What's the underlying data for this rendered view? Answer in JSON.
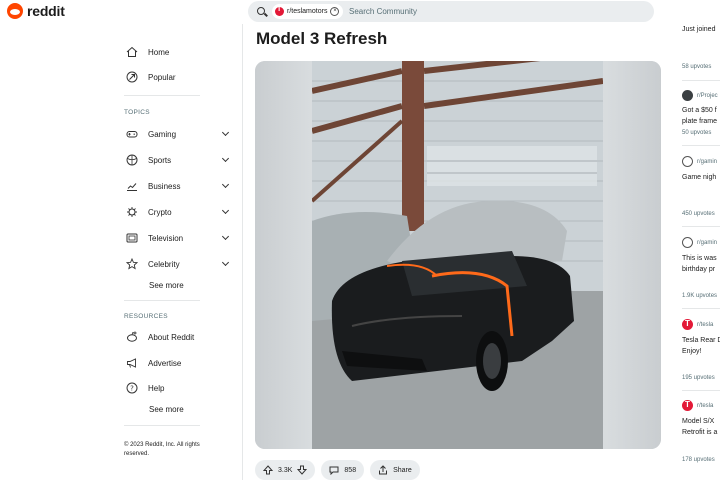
{
  "header": {
    "logo_text": "reddit",
    "search_chip": "r/teslamotors",
    "search_placeholder": "Search Community"
  },
  "sidebar": {
    "main": [
      {
        "label": "Home",
        "icon": "home-icon"
      },
      {
        "label": "Popular",
        "icon": "popular-icon"
      }
    ],
    "topics_label": "TOPICS",
    "topics": [
      {
        "label": "Gaming",
        "icon": "gamepad-icon"
      },
      {
        "label": "Sports",
        "icon": "ball-icon"
      },
      {
        "label": "Business",
        "icon": "chart-icon"
      },
      {
        "label": "Crypto",
        "icon": "crypto-icon"
      },
      {
        "label": "Television",
        "icon": "tv-icon"
      },
      {
        "label": "Celebrity",
        "icon": "star-icon"
      }
    ],
    "see_more": "See more",
    "resources_label": "RESOURCES",
    "resources": [
      {
        "label": "About Reddit",
        "icon": "reddit-icon"
      },
      {
        "label": "Advertise",
        "icon": "megaphone-icon"
      },
      {
        "label": "Help",
        "icon": "help-icon"
      }
    ],
    "see_more_2": "See more",
    "copyright": "© 2023 Reddit, Inc. All rights reserved."
  },
  "post": {
    "title": "Model 3 Refresh",
    "upvotes": "3.3K",
    "comments": "858",
    "share": "Share"
  },
  "right": {
    "top_text": "Just joined",
    "items": [
      {
        "meta": "58 upvotes"
      },
      {
        "sub": "r/Projec",
        "lines": [
          "Got a $50 f",
          "plate frame"
        ],
        "meta": "50 upvotes"
      },
      {
        "sub": "r/gamin",
        "lines": [
          "Game nigh"
        ],
        "meta": "450 upvotes"
      },
      {
        "sub": "r/gamin",
        "lines": [
          "This is was",
          "birthday pr"
        ],
        "meta": "1.9K upvotes"
      },
      {
        "sub": "r/tesla",
        "lines": [
          "Tesla Rear D",
          "Enjoy!"
        ],
        "meta": "195 upvotes"
      },
      {
        "sub": "r/tesla",
        "lines": [
          "Model S/X",
          "Retrofit is a"
        ],
        "meta": "178 upvotes"
      }
    ]
  },
  "colors": {
    "brand": "#ff4500",
    "tesla_red": "#e31937",
    "search_bg": "#eaedef"
  }
}
